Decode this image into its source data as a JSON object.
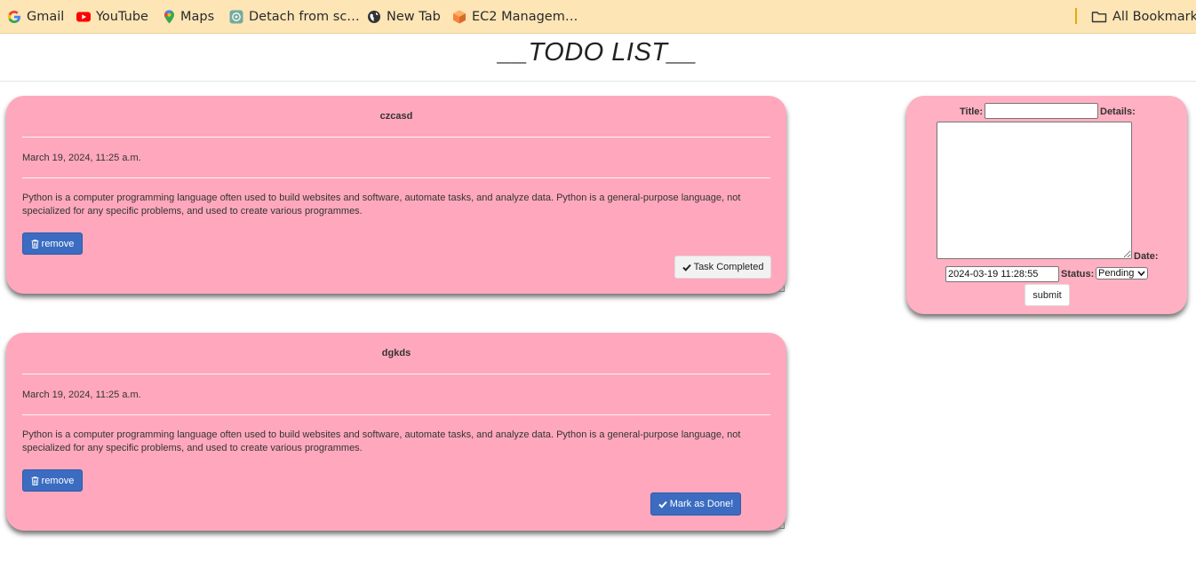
{
  "bookmarks": {
    "items": [
      {
        "label": "Gmail",
        "icon": "google-icon"
      },
      {
        "label": "YouTube",
        "icon": "youtube-icon"
      },
      {
        "label": "Maps",
        "icon": "maps-pin-icon"
      },
      {
        "label": "Detach from sc…",
        "icon": "chatgpt-icon"
      },
      {
        "label": "New Tab",
        "icon": "globe-icon"
      },
      {
        "label": "EC2 Managem…",
        "icon": "aws-icon"
      }
    ],
    "all_bookmarks": "All Bookmarks"
  },
  "page": {
    "title": "__TODO LIST__"
  },
  "tasks": [
    {
      "title": "czcasd",
      "date": "March 19, 2024, 11:25 a.m.",
      "details": "Python is a computer programming language often used to build websites and software, automate tasks, and analyze data. Python is a general-purpose language, not specialized for any specific problems, and used to create various programmes.",
      "remove_label": "remove",
      "status_button_label": "Task Completed"
    },
    {
      "title": "dgkds",
      "date": "March 19, 2024, 11:25 a.m.",
      "details": "Python is a computer programming language often used to build websites and software, automate tasks, and analyze data. Python is a general-purpose language, not specialized for any specific problems, and used to create various programmes.",
      "remove_label": "remove",
      "status_button_label": "Mark as Done!"
    }
  ],
  "form": {
    "title_label": "Title:",
    "title_value": "",
    "details_label": "Details:",
    "details_value": "",
    "date_label": "Date:",
    "date_value": "2024-03-19 11:28:55",
    "status_label": "Status:",
    "status_value": "Pending",
    "submit_label": "submit"
  },
  "colors": {
    "bookmarks_bg": "#fde5b6",
    "card_bg": "#ffa8bd",
    "form_bg": "#ffb0c2",
    "button_blue": "#3b6cc1"
  }
}
